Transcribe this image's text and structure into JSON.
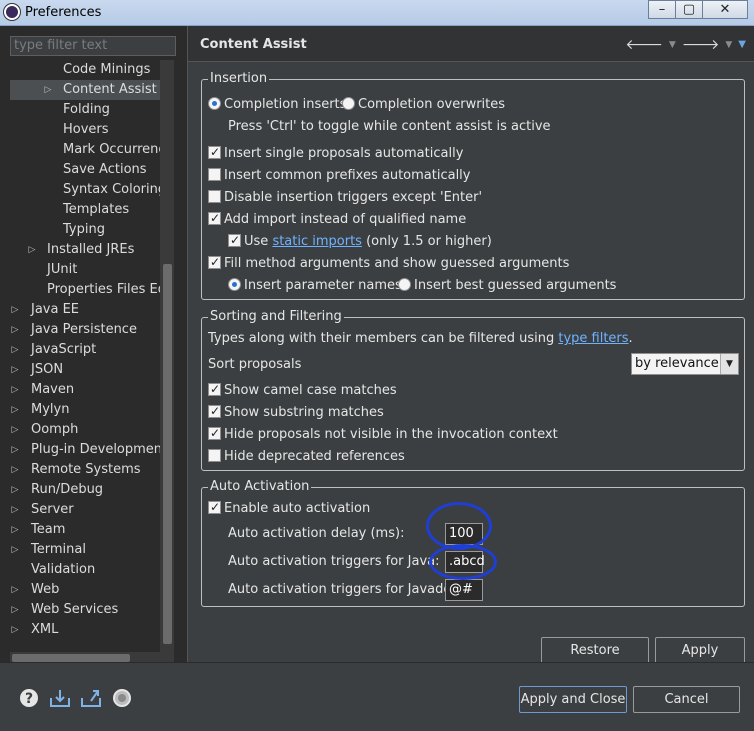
{
  "window": {
    "title": "Preferences",
    "minimize": "–",
    "restore": "▢",
    "close": "✕"
  },
  "filter": {
    "placeholder": "type filter text"
  },
  "tree": {
    "items": [
      {
        "label": "Code Minings"
      },
      {
        "label": "Content Assist"
      },
      {
        "label": "Folding"
      },
      {
        "label": "Hovers"
      },
      {
        "label": "Mark Occurrences"
      },
      {
        "label": "Save Actions"
      },
      {
        "label": "Syntax Coloring"
      },
      {
        "label": "Templates"
      },
      {
        "label": "Typing"
      },
      {
        "label": "Installed JREs"
      },
      {
        "label": "JUnit"
      },
      {
        "label": "Properties Files Editor"
      },
      {
        "label": "Java EE"
      },
      {
        "label": "Java Persistence"
      },
      {
        "label": "JavaScript"
      },
      {
        "label": "JSON"
      },
      {
        "label": "Maven"
      },
      {
        "label": "Mylyn"
      },
      {
        "label": "Oomph"
      },
      {
        "label": "Plug-in Development"
      },
      {
        "label": "Remote Systems"
      },
      {
        "label": "Run/Debug"
      },
      {
        "label": "Server"
      },
      {
        "label": "Team"
      },
      {
        "label": "Terminal"
      },
      {
        "label": "Validation"
      },
      {
        "label": "Web"
      },
      {
        "label": "Web Services"
      },
      {
        "label": "XML"
      }
    ]
  },
  "page": {
    "title": "Content Assist"
  },
  "insertion": {
    "legend": "Insertion",
    "radio_inserts": "Completion inserts",
    "radio_overwrites": "Completion overwrites",
    "toggle_hint": "Press 'Ctrl' to toggle while content assist is active",
    "single_proposals": "Insert single proposals automatically",
    "common_prefixes": "Insert common prefixes automatically",
    "disable_triggers": "Disable insertion triggers except 'Enter'",
    "add_import": "Add import instead of qualified name",
    "use_prefix": "Use",
    "static_imports": "static imports",
    "static_suffix": "(only 1.5 or higher)",
    "fill_args": "Fill method arguments and show guessed arguments",
    "param_names": "Insert parameter names",
    "best_guessed": "Insert best guessed arguments"
  },
  "sorting": {
    "legend": "Sorting and Filtering",
    "types_text": "Types along with their members can be filtered using",
    "type_filters": "type filters",
    "period": ".",
    "sort_label": "Sort proposals",
    "sort_value": "by relevance",
    "camel": "Show camel case matches",
    "substring": "Show substring matches",
    "hide_invisible": "Hide proposals not visible in the invocation context",
    "hide_deprecated": "Hide deprecated references"
  },
  "auto": {
    "legend": "Auto Activation",
    "enable": "Enable auto activation",
    "delay_label": "Auto activation delay (ms):",
    "delay_value": "100",
    "java_label": "Auto activation triggers for Java:",
    "java_value": ".abcd",
    "javadoc_label": "Auto activation triggers for Javadoc:",
    "javadoc_value": "@#"
  },
  "buttons": {
    "restore_defaults": "Restore Defaults",
    "apply": "Apply",
    "apply_close": "Apply and Close",
    "cancel": "Cancel"
  },
  "icons": [
    "help-icon",
    "import-icon",
    "export-icon",
    "oomph-icon"
  ],
  "colors": {
    "annotation": "#1f3ed6",
    "link": "#6fb3ff",
    "background": "#3c3f41"
  }
}
